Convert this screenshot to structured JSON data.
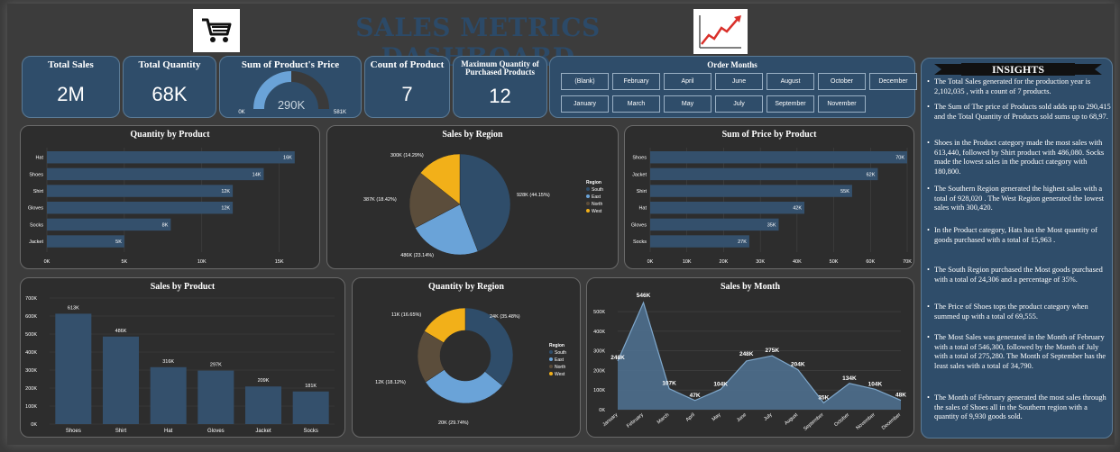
{
  "header": {
    "title": "SALES  METRICS DASHBOARD",
    "left_icon": "shopping-cart-icon",
    "right_icon": "rising-line-chart-icon"
  },
  "kpis": {
    "total_sales": {
      "label": "Total Sales",
      "value": "2M"
    },
    "total_quantity": {
      "label": "Total Quantity",
      "value": "68K"
    },
    "sum_price": {
      "label": "Sum of Product's Price",
      "value": "290K",
      "min": "0K",
      "max": "581K",
      "fill_fraction": 0.5
    },
    "count_product": {
      "label": "Count of Product",
      "value": "7"
    },
    "max_quantity": {
      "label": "Maximum Quantity of Purchased Products",
      "value": "12"
    }
  },
  "order_months": {
    "title": "Order Months",
    "row1": [
      "(Blank)",
      "February",
      "April",
      "June",
      "August",
      "October",
      "December"
    ],
    "row2": [
      "January",
      "March",
      "May",
      "July",
      "September",
      "November"
    ]
  },
  "colors": {
    "bar": "#34506c",
    "south": "#2f4d6a",
    "east": "#6aa3d8",
    "north": "#5b4d3b",
    "west": "#f2b019",
    "panel": "#2d2d2d",
    "kpi": "#2f4d6a"
  },
  "chart_data": [
    {
      "id": "quantity_by_product",
      "type": "bar",
      "orientation": "horizontal",
      "title": "Quantity by Product",
      "categories": [
        "Hat",
        "Shoes",
        "Shirt",
        "Gloves",
        "Socks",
        "Jacket"
      ],
      "values": [
        16000,
        14000,
        12000,
        12000,
        8000,
        5000
      ],
      "data_labels": [
        "16K",
        "14K",
        "12K",
        "12K",
        "8K",
        "5K"
      ],
      "xticks": [
        "0K",
        "5K",
        "10K",
        "15K"
      ],
      "xlim": [
        0,
        17000
      ]
    },
    {
      "id": "sales_by_region",
      "type": "pie",
      "title": "Sales by Region",
      "legend_title": "Region",
      "categories": [
        "South",
        "East",
        "North",
        "West"
      ],
      "values": [
        928000,
        486000,
        387000,
        300000
      ],
      "data_labels": [
        "928K (44.15%)",
        "486K (23.14%)",
        "387K (18.42%)",
        "300K (14.29%)"
      ]
    },
    {
      "id": "sum_price_by_product",
      "type": "bar",
      "orientation": "horizontal",
      "title": "Sum of Price by Product",
      "categories": [
        "Shoes",
        "Jacket",
        "Shirt",
        "Hat",
        "Gloves",
        "Socks"
      ],
      "values": [
        70000,
        62000,
        55000,
        42000,
        35000,
        27000
      ],
      "data_labels": [
        "70K",
        "62K",
        "55K",
        "42K",
        "35K",
        "27K"
      ],
      "xticks": [
        "0K",
        "10K",
        "20K",
        "30K",
        "40K",
        "50K",
        "60K",
        "70K"
      ],
      "xlim": [
        0,
        70000
      ]
    },
    {
      "id": "sales_by_product",
      "type": "bar",
      "orientation": "vertical",
      "title": "Sales by Product",
      "categories": [
        "Shoes",
        "Shirt",
        "Hat",
        "Gloves",
        "Jacket",
        "Socks"
      ],
      "values": [
        613000,
        486000,
        316000,
        297000,
        209000,
        181000
      ],
      "data_labels": [
        "613K",
        "486K",
        "316K",
        "297K",
        "209K",
        "181K"
      ],
      "yticks": [
        "0K",
        "100K",
        "200K",
        "300K",
        "400K",
        "500K",
        "600K",
        "700K"
      ],
      "ylim": [
        0,
        700000
      ]
    },
    {
      "id": "quantity_by_region",
      "type": "donut",
      "title": "Quantity by Region",
      "legend_title": "Region",
      "categories": [
        "South",
        "East",
        "North",
        "West"
      ],
      "values": [
        24000,
        20000,
        12000,
        11000
      ],
      "data_labels": [
        "24K (35.48%)",
        "20K (29.74%)",
        "12K (18.12%)",
        "11K (16.65%)"
      ]
    },
    {
      "id": "sales_by_month",
      "type": "area",
      "title": "Sales by Month",
      "categories": [
        "January",
        "February",
        "March",
        "April",
        "May",
        "June",
        "July",
        "August",
        "September",
        "October",
        "November",
        "December"
      ],
      "values": [
        248000,
        546000,
        107000,
        47000,
        104000,
        248000,
        275000,
        204000,
        35000,
        134000,
        104000,
        48000
      ],
      "data_labels": [
        "248K",
        "546K",
        "107K",
        "47K",
        "104K",
        "248K",
        "275K",
        "204K",
        "35K",
        "134K",
        "104K",
        "48K"
      ],
      "yticks": [
        "0K",
        "100K",
        "200K",
        "300K",
        "400K",
        "500K"
      ],
      "ylim": [
        0,
        560000
      ]
    }
  ],
  "insights": {
    "title": "INSIGHTS",
    "items": [
      "The Total Sales generated for the production year is 2,102,035 , with a count of 7 products.",
      "The Sum of The price of Products sold adds up to 290,415 and the Total Quantity of Products sold sums up to  68,97.",
      "Shoes in the Product category made the most sales with  613,440, followed by  Shirt product with  486,080.  Socks  made the lowest sales  in the product category with  180,800.",
      "The Southern Region generated the highest sales with   a total of 928,020 . The West Region generated the lowest sales with 300,420.",
      "In the Product category, Hats has the Most quantity of goods purchased with  a total of 15,963 .",
      "The South Region purchased the Most goods purchased with a total of  24,306 and a percentage of 35%.",
      "The Price of Shoes tops the product category when summed up with a total of  69,555.",
      "The Most Sales was generated in the Month of February with a total of  546,300, followed by the Month of  July with a total of 275,280. The Month of  September has the least sales with a total of 34,790.",
      "The Month of February generated the most sales through the sales of Shoes all in the Southern region with a quantity of 9,930 goods sold."
    ]
  }
}
